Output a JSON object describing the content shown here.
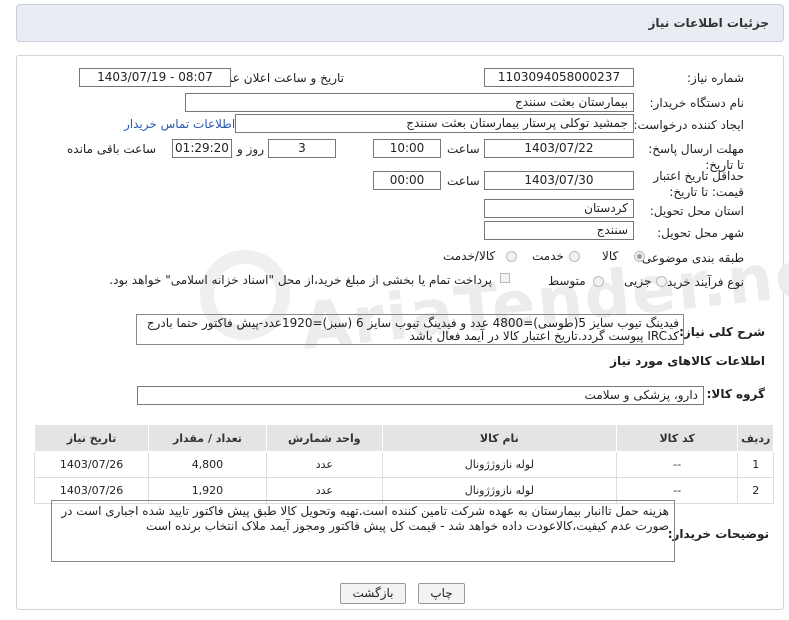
{
  "header": {
    "title": "جزئیات اطلاعات نیاز"
  },
  "fields": {
    "need_number_label": "شماره نیاز:",
    "need_number": "1103094058000237",
    "announce_label": "تاریخ و ساعت اعلان عمومی:",
    "announce_value": "1403/07/19 - 08:07",
    "buyer_org_label": "نام دستگاه خریدار:",
    "buyer_org": "بیمارستان بعثت سنندج",
    "creator_label": "ایجاد کننده درخواست:",
    "creator": "جمشید  توکلی پرستار بیمارستان بعثت سنندج",
    "contact_link": "اطلاعات تماس خریدار",
    "deadline_label": "مهلت ارسال پاسخ: تا تاریخ:",
    "deadline_date": "1403/07/22",
    "hour_label": "ساعت",
    "deadline_time": "10:00",
    "days_value": "3",
    "days_label": "روز و",
    "remaining_time": "01:29:20",
    "remaining_label": "ساعت باقی مانده",
    "validity_label": "حداقل تاریخ اعتبار قیمت: تا تاریخ:",
    "validity_date": "1403/07/30",
    "validity_time": "00:00",
    "province_label": "استان محل تحویل:",
    "province": "کردستان",
    "city_label": "شهر محل تحویل:",
    "city": "سنندج",
    "category_label": "طبقه بندی موضوعی:",
    "category_goods": "کالا",
    "category_service": "خدمت",
    "category_both": "کالا/خدمت",
    "process_label": "نوع فرآیند خرید :",
    "process_partial": "جزیی",
    "process_medium": "متوسط",
    "process_note": "پرداخت تمام یا بخشی از مبلغ خرید،از محل \"اسناد خزانه اسلامی\" خواهد بود."
  },
  "description": {
    "label": "شرح کلی نیاز:",
    "text": "فیدینگ تیوب سایز 5(طوسی)=4800 عدد و فیدینگ تیوب سایز 6 (سبز)=1920عدد-پیش فاکتور حتما بادرج کدIRC پیوست گردد.تاریخ  اعتبار کالا در آیمد فعال باشد"
  },
  "goods": {
    "section_title": "اطلاعات کالاهای مورد نیاز",
    "group_label": "گروه کالا:",
    "group_value": "دارو، پزشکی و سلامت",
    "columns": [
      "ردیف",
      "کد کالا",
      "نام کالا",
      "واحد شمارش",
      "تعداد / مقدار",
      "تاریخ نیاز"
    ],
    "rows": [
      [
        "1",
        "--",
        "لوله نازوژژونال",
        "عدد",
        "4,800",
        "1403/07/26"
      ],
      [
        "2",
        "--",
        "لوله نازوژژونال",
        "عدد",
        "1,920",
        "1403/07/26"
      ]
    ]
  },
  "buyer_notes": {
    "label": "توضیحات خریدار:",
    "text": "هزینه حمل تاانبار بیمارستان به عهده شرکت تامین کننده است.تهیه وتحویل کالا طبق پیش فاکتور تایید شده اجباری است در صورت عدم کیفیت،کالاعودت داده خواهد شد - قیمت کل پیش فاکتور ومجوز آیمد ملاک انتخاب برنده است"
  },
  "buttons": {
    "print": "چاپ",
    "back": "بازگشت"
  },
  "watermark": "AriaTender.net"
}
